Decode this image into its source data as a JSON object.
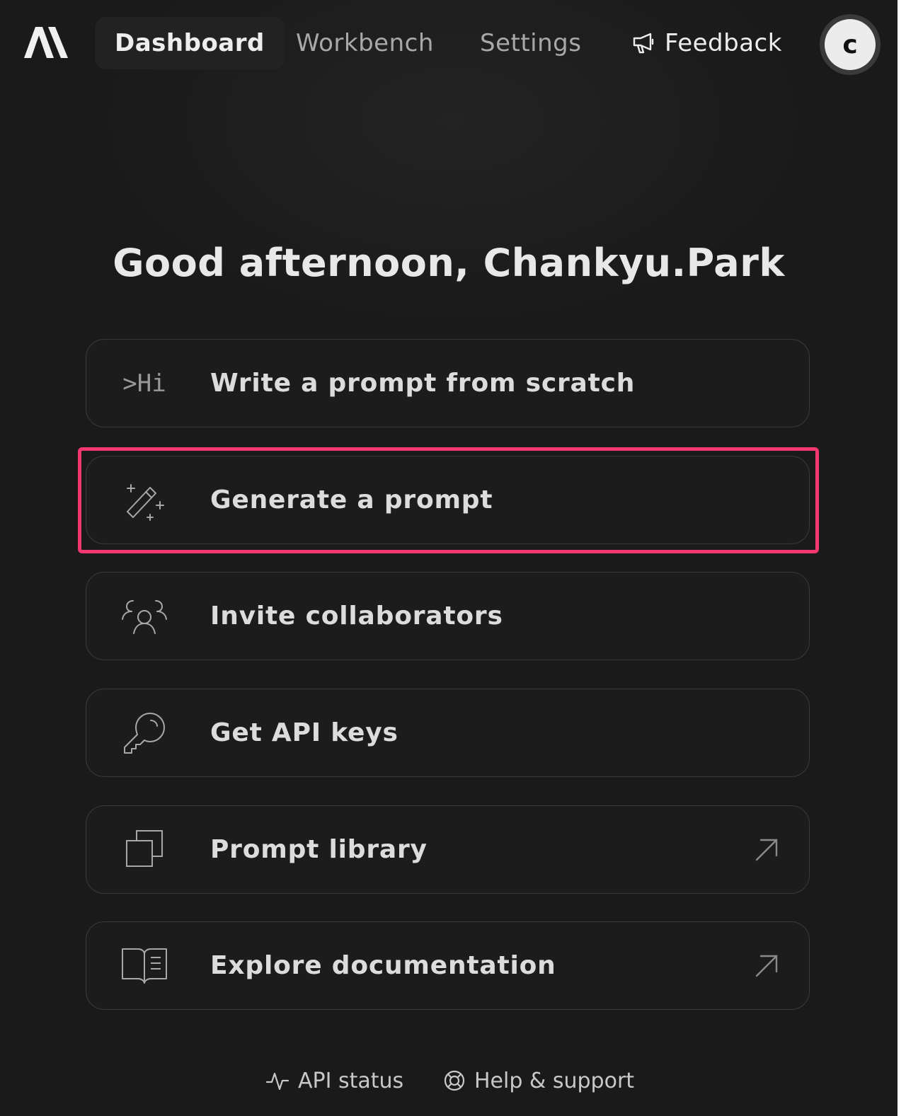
{
  "nav": {
    "items": [
      {
        "label": "Dashboard",
        "active": true
      },
      {
        "label": "Workbench",
        "active": false
      },
      {
        "label": "Settings",
        "active": false
      }
    ],
    "feedback_label": "Feedback",
    "avatar_initial": "c"
  },
  "greeting": "Good afternoon, Chankyu.Park",
  "actions": [
    {
      "label": "Write a prompt from scratch",
      "icon": "prompt-hi-icon",
      "icon_text": ">Hi",
      "external": false
    },
    {
      "label": "Generate a prompt",
      "icon": "magic-wand-icon",
      "external": false,
      "highlighted": true
    },
    {
      "label": "Invite collaborators",
      "icon": "users-icon",
      "external": false
    },
    {
      "label": "Get API keys",
      "icon": "key-icon",
      "external": false
    },
    {
      "label": "Prompt library",
      "icon": "copy-stack-icon",
      "external": true
    },
    {
      "label": "Explore documentation",
      "icon": "book-icon",
      "external": true
    }
  ],
  "footer": {
    "api_status_label": "API status",
    "help_label": "Help & support"
  },
  "colors": {
    "background": "#1a1a1a",
    "card_border": "#3a3a3a",
    "highlight": "#f2386e",
    "text": "#dcdcdc"
  }
}
